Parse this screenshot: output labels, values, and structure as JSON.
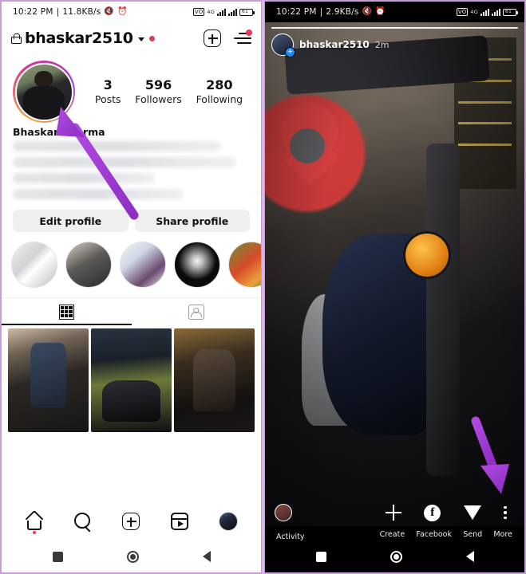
{
  "left_phone": {
    "status_bar": {
      "time": "10:22 PM",
      "separator": "|",
      "network_speed": "11.8KB/s",
      "mute_icon": "mute-icon",
      "alarm_icon": "alarm-icon",
      "vowifi_icon": "vowifi-icon",
      "network_type": "4G",
      "signal_icon": "signal-bars-icon",
      "signal2_icon": "signal-bars-secondary-icon",
      "battery_level": "61",
      "battery_icon": "battery-icon"
    },
    "header": {
      "lock_icon": "lock-icon",
      "username": "bhaskar2510",
      "chevron_icon": "chevron-down-icon",
      "status_dot": "red-dot-indicator",
      "add_icon": "plus-square-icon",
      "menu_icon": "hamburger-menu-icon",
      "menu_badge": "notification-dot"
    },
    "profile": {
      "avatar": "profile-avatar",
      "full_name": "Bhaskar Sharma",
      "bio_redacted": true,
      "stats": [
        {
          "num": "3",
          "label": "Posts"
        },
        {
          "num": "596",
          "label": "Followers"
        },
        {
          "num": "280",
          "label": "Following"
        }
      ],
      "buttons": [
        {
          "label": "Edit profile"
        },
        {
          "label": "Share profile"
        }
      ]
    },
    "highlights": [
      {
        "name": "highlight-1"
      },
      {
        "name": "highlight-2"
      },
      {
        "name": "highlight-3"
      },
      {
        "name": "highlight-4"
      },
      {
        "name": "highlight-5"
      }
    ],
    "tabs": [
      {
        "icon": "grid-icon",
        "active": true
      },
      {
        "icon": "tagged-icon",
        "active": false
      }
    ],
    "posts": [
      {
        "name": "post-1"
      },
      {
        "name": "post-2"
      },
      {
        "name": "post-3"
      }
    ],
    "bottom_nav": [
      {
        "icon": "home-icon",
        "active": true
      },
      {
        "icon": "search-icon",
        "active": false
      },
      {
        "icon": "create-plus-icon",
        "active": false
      },
      {
        "icon": "reels-icon",
        "active": false
      },
      {
        "icon": "profile-avatar-icon",
        "active": false
      }
    ],
    "android_nav": [
      {
        "icon": "recents-square-icon"
      },
      {
        "icon": "home-circle-icon"
      },
      {
        "icon": "back-triangle-icon"
      }
    ]
  },
  "right_phone": {
    "status_bar": {
      "time": "10:22 PM",
      "separator": "|",
      "network_speed": "2.9KB/s",
      "mute_icon": "mute-icon",
      "alarm_icon": "alarm-icon",
      "vowifi_icon": "vowifi-icon",
      "network_type": "4G",
      "signal_icon": "signal-bars-icon",
      "signal2_icon": "signal-bars-secondary-icon",
      "battery_level": "61",
      "battery_icon": "battery-icon"
    },
    "story": {
      "progress_icon": "story-progress-bar",
      "avatar": "story-author-avatar",
      "add_story_icon": "add-story-plus-icon",
      "username": "bhaskar2510",
      "timestamp": "2m",
      "photo": "motorcycle-story-photo"
    },
    "actions": [
      {
        "label": "Activity",
        "icon": "activity-avatar-icon"
      },
      {
        "label": "Create",
        "icon": "create-plus-icon"
      },
      {
        "label": "Facebook",
        "icon": "facebook-icon"
      },
      {
        "label": "Send",
        "icon": "send-paperplane-icon"
      },
      {
        "label": "More",
        "icon": "more-dots-icon"
      }
    ],
    "android_nav": [
      {
        "icon": "recents-square-icon"
      },
      {
        "icon": "home-circle-icon"
      },
      {
        "icon": "back-triangle-icon"
      }
    ]
  },
  "annotations": [
    {
      "name": "arrow-to-profile-avatar",
      "color": "#a43fd8"
    },
    {
      "name": "arrow-to-more-button",
      "color": "#a43fd8"
    }
  ],
  "colors": {
    "frame_border": "#c99de0",
    "arrow": "#a43fd8",
    "accent_red": "#e8385a"
  }
}
